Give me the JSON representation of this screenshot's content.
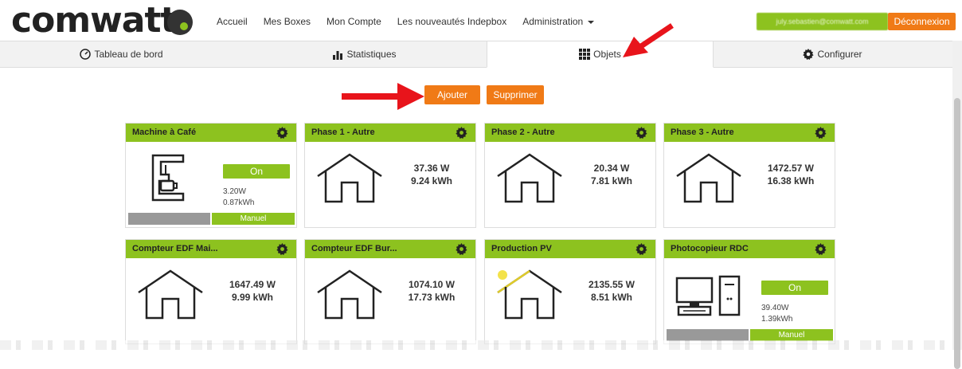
{
  "logo": {
    "text": "comwatt"
  },
  "nav": {
    "items": [
      "Accueil",
      "Mes Boxes",
      "Mon Compte",
      "Les nouveautés Indepbox",
      "Administration"
    ]
  },
  "user": {
    "email": "july.sebastien@comwatt.com",
    "logout_label": "Déconnexion"
  },
  "tabs": [
    {
      "label": "Tableau de bord",
      "icon": "gauge-icon"
    },
    {
      "label": "Statistiques",
      "icon": "bar-chart-icon"
    },
    {
      "label": "Objets",
      "icon": "grid-icon"
    },
    {
      "label": "Configurer",
      "icon": "gear-icon"
    }
  ],
  "actions": {
    "add_label": "Ajouter",
    "delete_label": "Supprimer"
  },
  "cards": [
    {
      "title": "Machine à Café",
      "type": "switch",
      "state": "On",
      "power": "3.20W",
      "energy": "0.87kWh",
      "mode": "Manuel"
    },
    {
      "title": "Phase 1 - Autre",
      "type": "meter",
      "power": "37.36 W",
      "energy": "9.24 kWh"
    },
    {
      "title": "Phase 2 - Autre",
      "type": "meter",
      "power": "20.34 W",
      "energy": "7.81 kWh"
    },
    {
      "title": "Phase 3 - Autre",
      "type": "meter",
      "power": "1472.57 W",
      "energy": "16.38 kWh"
    },
    {
      "title": "Compteur EDF Mai...",
      "type": "meter",
      "power": "1647.49 W",
      "energy": "9.99 kWh"
    },
    {
      "title": "Compteur EDF Bur...",
      "type": "meter",
      "power": "1074.10 W",
      "energy": "17.73 kWh"
    },
    {
      "title": "Production PV",
      "type": "meter",
      "power": "2135.55 W",
      "energy": "8.51 kWh"
    },
    {
      "title": "Photocopieur RDC",
      "type": "switch",
      "state": "On",
      "power": "39.40W",
      "energy": "1.39kWh",
      "mode": "Manuel"
    }
  ],
  "colors": {
    "green": "#8dc21f",
    "orange": "#f07a16",
    "arrow": "#e8141b"
  }
}
